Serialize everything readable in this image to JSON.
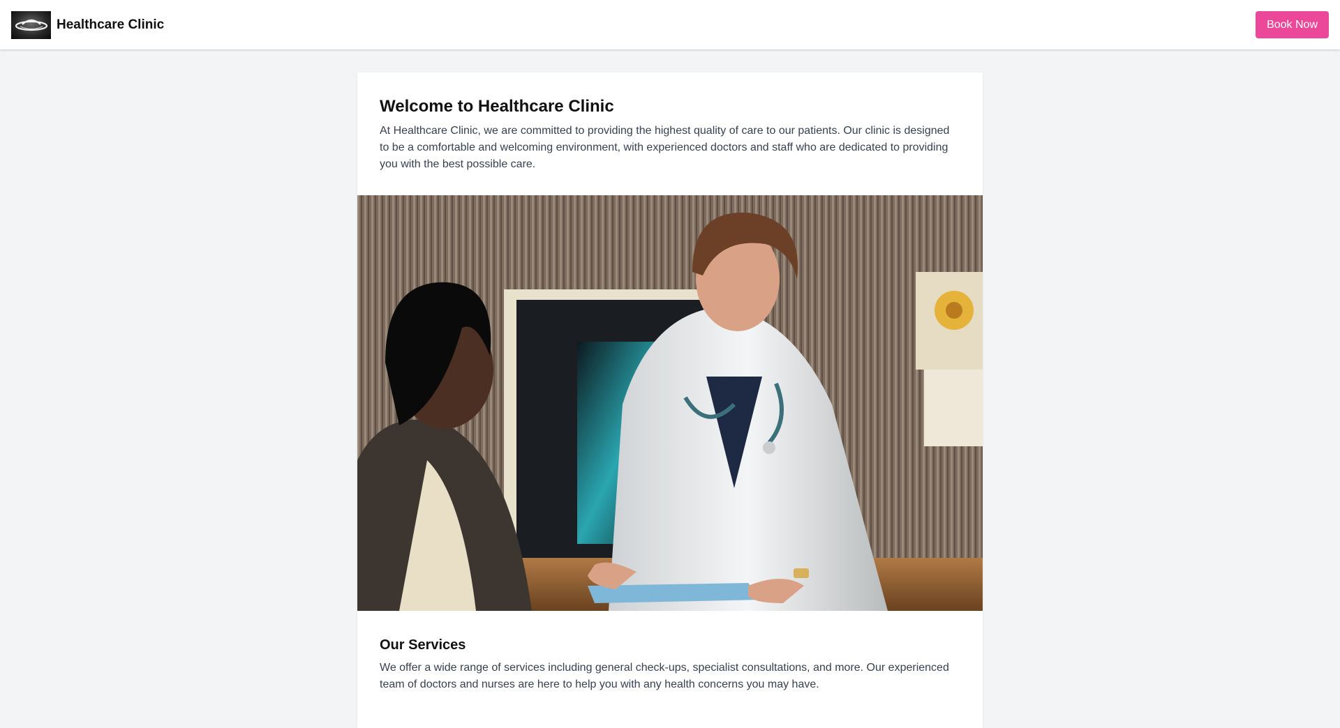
{
  "header": {
    "logo_icon": "clinic-logo",
    "brand_name": "Healthcare Clinic",
    "book_label": "Book Now",
    "accent_color": "#ec4899"
  },
  "intro": {
    "title": "Welcome to Healthcare Clinic",
    "body": "At Healthcare Clinic, we are committed to providing the highest quality of care to our patients. Our clinic is designed to be a comfortable and welcoming environment, with experienced doctors and staff who are dedicated to providing you with the best possible care."
  },
  "hero_image": {
    "icon": "doctor-consultation-photo"
  },
  "services": {
    "title": "Our Services",
    "body": "We offer a wide range of services including general check-ups, specialist consultations, and more. Our experienced team of doctors and nurses are here to help you with any health concerns you may have."
  }
}
